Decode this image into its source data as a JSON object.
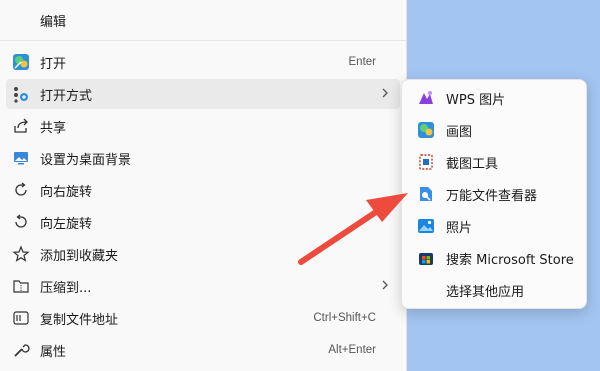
{
  "context_menu": {
    "items": [
      {
        "label": "编辑",
        "icon": "none"
      },
      {
        "label": "打开",
        "shortcut": "Enter",
        "icon": "paint-app-icon"
      },
      {
        "label": "打开方式",
        "icon": "open-with-icon",
        "has_submenu": true
      },
      {
        "label": "共享",
        "icon": "share-icon"
      },
      {
        "label": "设置为桌面背景",
        "icon": "wallpaper-icon"
      },
      {
        "label": "向右旋转",
        "icon": "rotate-right-icon"
      },
      {
        "label": "向左旋转",
        "icon": "rotate-left-icon"
      },
      {
        "label": "添加到收藏夹",
        "icon": "star-icon"
      },
      {
        "label": "压缩到...",
        "icon": "zip-icon",
        "has_submenu": true
      },
      {
        "label": "复制文件地址",
        "shortcut": "Ctrl+Shift+C",
        "icon": "copy-path-icon"
      },
      {
        "label": "属性",
        "shortcut": "Alt+Enter",
        "icon": "properties-icon"
      }
    ]
  },
  "submenu": {
    "items": [
      {
        "label": "WPS 图片",
        "icon": "wps-pictures-icon"
      },
      {
        "label": "画图",
        "icon": "paint-icon"
      },
      {
        "label": "截图工具",
        "icon": "snipping-tool-icon"
      },
      {
        "label": "万能文件查看器",
        "icon": "file-viewer-icon"
      },
      {
        "label": "照片",
        "icon": "photos-icon"
      },
      {
        "label": "搜索 Microsoft Store",
        "icon": "microsoft-store-icon"
      },
      {
        "label": "选择其他应用",
        "icon": "none"
      }
    ]
  },
  "colors": {
    "desktop": "#a3c5f2",
    "menu_bg": "#f9f9f9",
    "hover": "#eaeaea",
    "annotation_arrow": "#ee4b3f"
  }
}
